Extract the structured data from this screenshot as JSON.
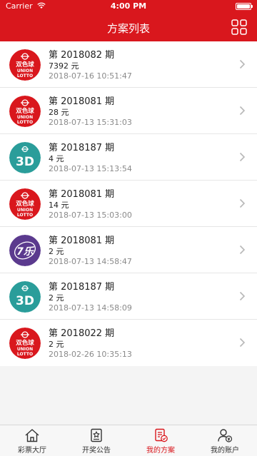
{
  "status": {
    "carrier": "Carrier",
    "time": "4:00 PM"
  },
  "header": {
    "title": "方案列表"
  },
  "colors": {
    "brand": "#d9171d",
    "teal": "#2a9d9a",
    "purple": "#5b3a8e"
  },
  "plans": [
    {
      "issue": "第 2018082 期",
      "amount": "7392 元",
      "time": "2018-07-16 10:51:47",
      "logo": "union-lotto"
    },
    {
      "issue": "第 2018081 期",
      "amount": "28 元",
      "time": "2018-07-13 15:31:03",
      "logo": "union-lotto"
    },
    {
      "issue": "第 2018187 期",
      "amount": "4 元",
      "time": "2018-07-13 15:13:54",
      "logo": "3d"
    },
    {
      "issue": "第 2018081 期",
      "amount": "14 元",
      "time": "2018-07-13 15:03:00",
      "logo": "union-lotto"
    },
    {
      "issue": "第 2018081 期",
      "amount": "2 元",
      "time": "2018-07-13 14:58:47",
      "logo": "qilecai"
    },
    {
      "issue": "第 2018187 期",
      "amount": "2 元",
      "time": "2018-07-13 14:58:09",
      "logo": "3d"
    },
    {
      "issue": "第 2018022 期",
      "amount": "2 元",
      "time": "2018-02-26 10:35:13",
      "logo": "union-lotto"
    }
  ],
  "logos": {
    "union_lotto": {
      "line1": "双色球",
      "line2": "UNION",
      "line3": "LOTTO"
    },
    "three_d": {
      "text": "3D"
    },
    "qilecai": {
      "text": "7乐"
    }
  },
  "tabs": [
    {
      "label": "彩票大厅",
      "icon": "home-icon",
      "active": false
    },
    {
      "label": "开奖公告",
      "icon": "award-icon",
      "active": false
    },
    {
      "label": "我的方案",
      "icon": "plan-icon",
      "active": true
    },
    {
      "label": "我的账户",
      "icon": "account-icon",
      "active": false
    }
  ]
}
